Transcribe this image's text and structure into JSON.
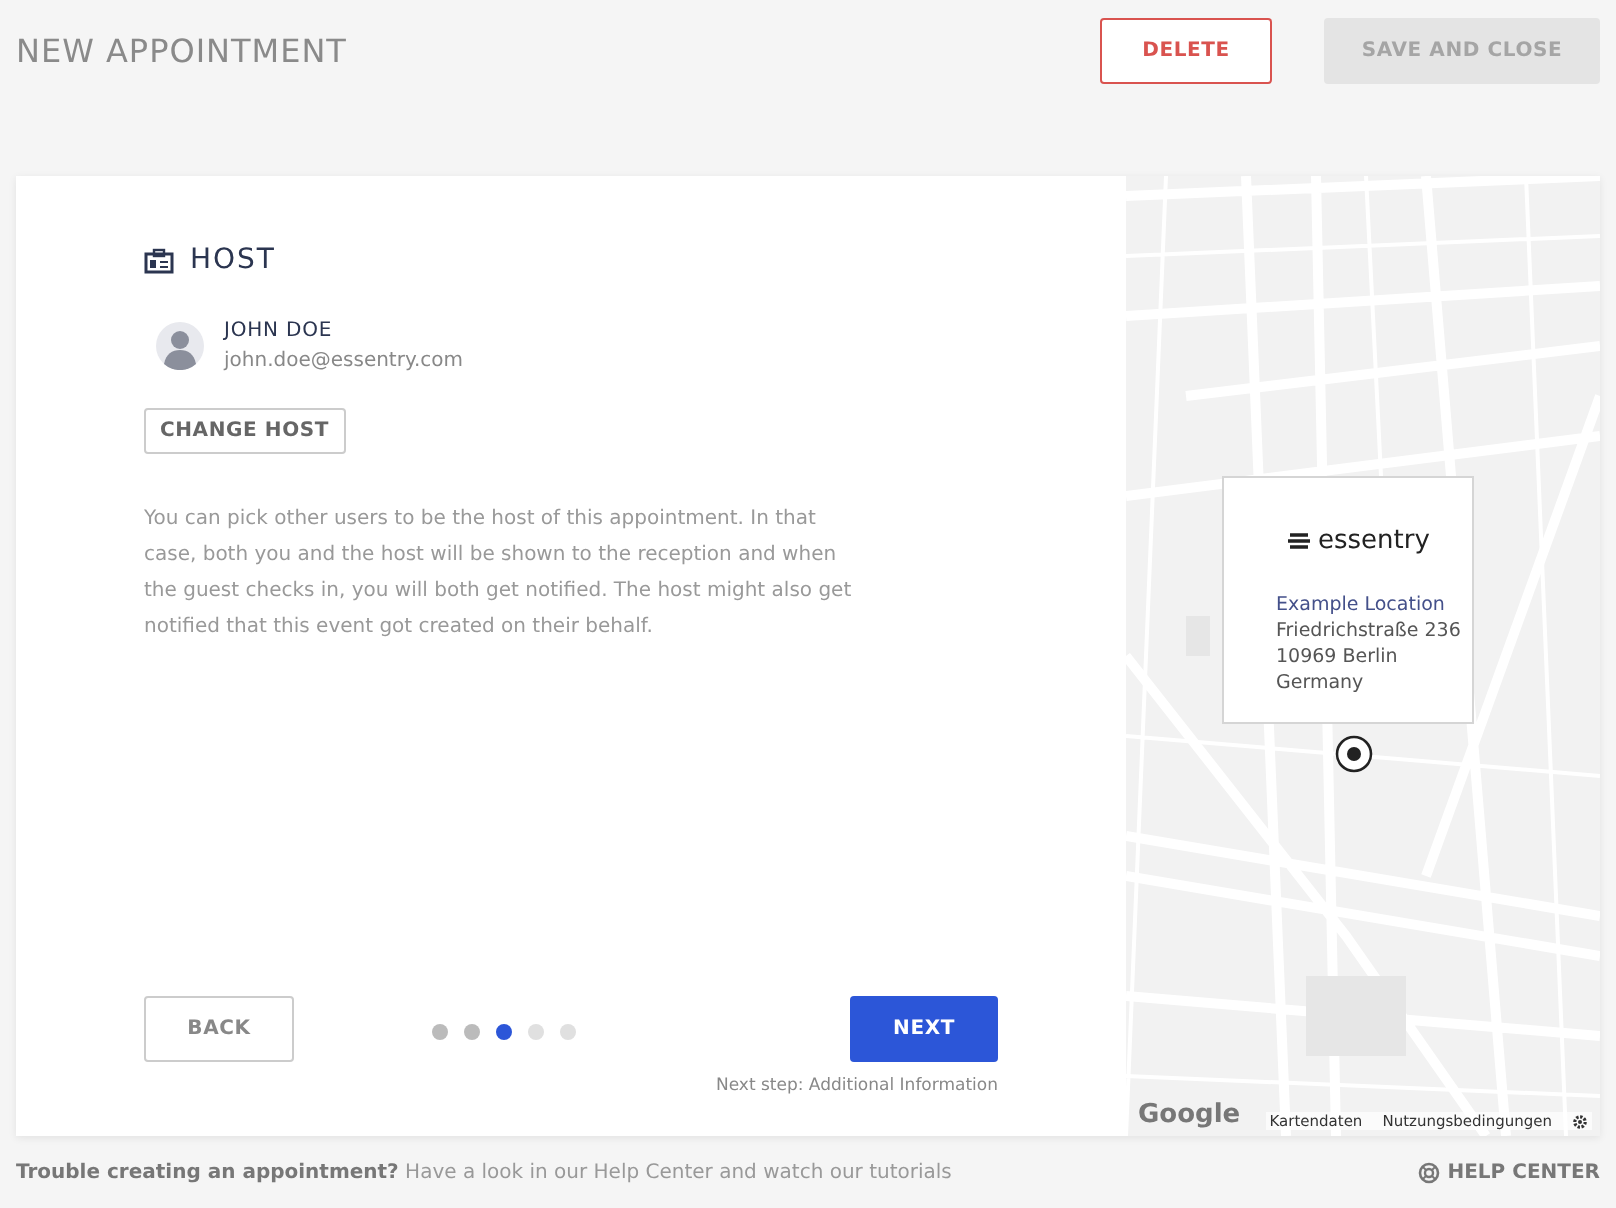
{
  "header": {
    "title": "NEW APPOINTMENT",
    "delete_button": "DELETE",
    "save_button": {
      "label": "SAVE AND CLOSE",
      "disabled": true
    }
  },
  "host": {
    "heading": "HOST",
    "name": "JOHN DOE",
    "email": "john.doe@essentry.com",
    "change_button": "CHANGE HOST",
    "description": "You can pick other users to be the host of this appointment. In that case, both you and the host will be shown to the reception and when the guest checks in, you will both get notified. The host might also get notified that this event got created on their behalf."
  },
  "navigation": {
    "back_button": "BACK",
    "next_button": "NEXT",
    "next_step": "Next step: Additional Information",
    "steps": [
      {
        "kind": "done"
      },
      {
        "kind": "done"
      },
      {
        "kind": "current"
      },
      {
        "kind": "upcoming"
      },
      {
        "kind": "upcoming"
      }
    ]
  },
  "map": {
    "logo": "essentry",
    "location_name": "Example Location",
    "address_lines": [
      "Friedrichstraße 236",
      "10969 Berlin",
      "Germany"
    ],
    "google_logo": "Google",
    "attribution": "Kartendaten",
    "terms": "Nutzungsbedingungen"
  },
  "footer": {
    "help_text": "**Trouble creating an appointment?** Have a look in our Help Center and watch our tutorials",
    "help_center": "HELP CENTER"
  }
}
